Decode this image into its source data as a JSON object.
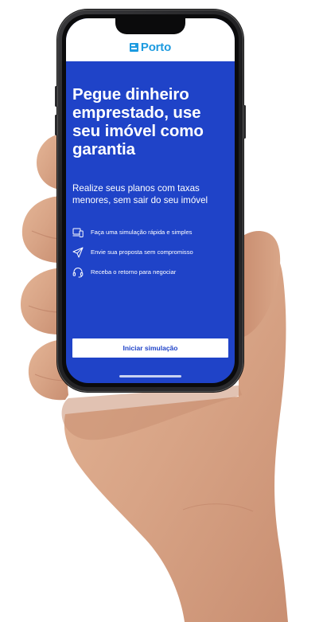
{
  "brand": {
    "name": "Porto",
    "logo_icon": "porto-logo-icon",
    "color": "#1d9be0"
  },
  "theme": {
    "screen_background": "#1f43c8",
    "header_background": "#ffffff",
    "text_color": "#ffffff"
  },
  "hero": {
    "title": "Pegue dinheiro emprestado, use seu imóvel como garantia",
    "subtitle": "Realize seus planos com taxas menores, sem sair do seu imóvel"
  },
  "features": [
    {
      "icon": "laptop-phone-icon",
      "label": "Faça uma simulação rápida e simples"
    },
    {
      "icon": "paper-plane-icon",
      "label": "Envie sua proposta sem compromisso"
    },
    {
      "icon": "headset-icon",
      "label": "Receba o retorno para negociar"
    }
  ],
  "cta": {
    "label": "Iniciar simulação"
  }
}
